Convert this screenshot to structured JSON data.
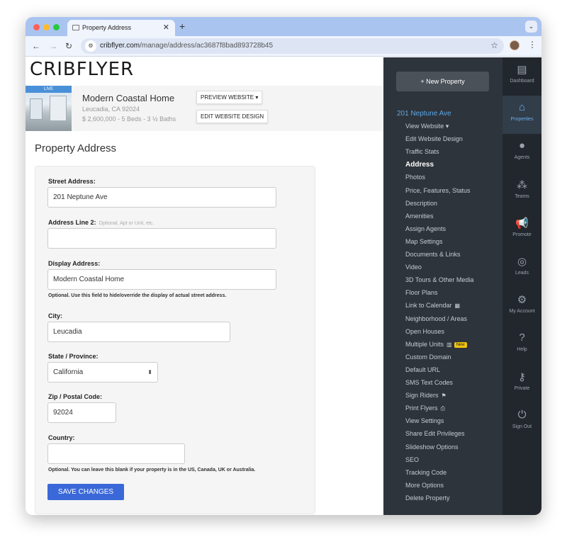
{
  "browser": {
    "tab_title": "Property Address",
    "url_domain": "cribflyer.com",
    "url_path": "/manage/address/ac3687f8bad893728b45"
  },
  "header": {
    "logo": "CRIBFLYER"
  },
  "property": {
    "live_badge": "LIVE",
    "name": "Modern Coastal Home",
    "location": "Leucadia, CA 92024",
    "info": "$ 2,600,000 - 5 Beds - 3 ½ Baths",
    "preview_button": "PREVIEW WEBSITE ▾",
    "edit_button": "EDIT WEBSITE DESIGN"
  },
  "page": {
    "title": "Property Address"
  },
  "form": {
    "street_label": "Street Address:",
    "street_value": "201 Neptune Ave",
    "line2_label": "Address Line 2:",
    "line2_hint": "Optional, Apt or Unit, etc.",
    "line2_value": "",
    "display_label": "Display Address:",
    "display_value": "Modern Coastal Home",
    "display_note": "Optional. Use this field to hide/override the display of actual street address.",
    "city_label": "City:",
    "city_value": "Leucadia",
    "state_label": "State / Province:",
    "state_value": "California",
    "zip_label": "Zip / Postal Code:",
    "zip_value": "92024",
    "country_label": "Country:",
    "country_value": "",
    "country_note": "Optional. You can leave this blank if your property is in the US, Canada, UK or Australia.",
    "save_button": "SAVE CHANGES"
  },
  "sidebar": {
    "new_property": "+ New Property",
    "address_heading": "201 Neptune Ave",
    "items": [
      {
        "label": "View Website ▾",
        "icon": ""
      },
      {
        "label": "Edit Website Design",
        "icon": ""
      },
      {
        "label": "Traffic Stats",
        "icon": ""
      },
      {
        "label": "Address",
        "icon": "",
        "active": true
      },
      {
        "label": "Photos",
        "icon": ""
      },
      {
        "label": "Price, Features, Status",
        "icon": ""
      },
      {
        "label": "Description",
        "icon": ""
      },
      {
        "label": "Amenities",
        "icon": ""
      },
      {
        "label": "Assign Agents",
        "icon": ""
      },
      {
        "label": "Map Settings",
        "icon": ""
      },
      {
        "label": "Documents & Links",
        "icon": ""
      },
      {
        "label": "Video",
        "icon": ""
      },
      {
        "label": "3D Tours & Other Media",
        "icon": ""
      },
      {
        "label": "Floor Plans",
        "icon": ""
      },
      {
        "label": "Link to Calendar",
        "icon": "calendar-icon"
      },
      {
        "label": "Neighborhood / Areas",
        "icon": ""
      },
      {
        "label": "Open Houses",
        "icon": ""
      },
      {
        "label": "Multiple Units",
        "icon": "building-icon",
        "badge": "New"
      },
      {
        "label": "Custom Domain",
        "icon": ""
      },
      {
        "label": "Default URL",
        "icon": ""
      },
      {
        "label": "SMS Text Codes",
        "icon": ""
      },
      {
        "label": "Sign Riders",
        "icon": "flag-icon"
      },
      {
        "label": "Print Flyers",
        "icon": "pdf-icon"
      },
      {
        "label": "View Settings",
        "icon": ""
      },
      {
        "label": "Share Edit Privileges",
        "icon": ""
      },
      {
        "label": "Slideshow Options",
        "icon": ""
      },
      {
        "label": "SEO",
        "icon": ""
      },
      {
        "label": "Tracking Code",
        "icon": ""
      },
      {
        "label": "More Options",
        "icon": ""
      },
      {
        "label": "Delete Property",
        "icon": ""
      }
    ]
  },
  "rail": {
    "items": [
      {
        "label": "Dashboard",
        "icon": "dashboard-icon"
      },
      {
        "label": "Properties",
        "icon": "properties-icon",
        "active": true
      },
      {
        "label": "Agents",
        "icon": "agent-icon"
      },
      {
        "label": "Teams",
        "icon": "teams-icon"
      },
      {
        "label": "Promote",
        "icon": "megaphone-icon"
      },
      {
        "label": "Leads",
        "icon": "target-icon"
      },
      {
        "label": "My Account",
        "icon": "gear-icon"
      },
      {
        "label": "Help",
        "icon": "help-icon"
      },
      {
        "label": "Private",
        "icon": "key-icon"
      },
      {
        "label": "Sign Out",
        "icon": "power-icon"
      }
    ]
  },
  "colors": {
    "accent_blue": "#3a68d8",
    "sidebar_bg": "#2e343b",
    "sidebar_link": "#5ba7e8",
    "new_badge": "#f1c40f"
  }
}
